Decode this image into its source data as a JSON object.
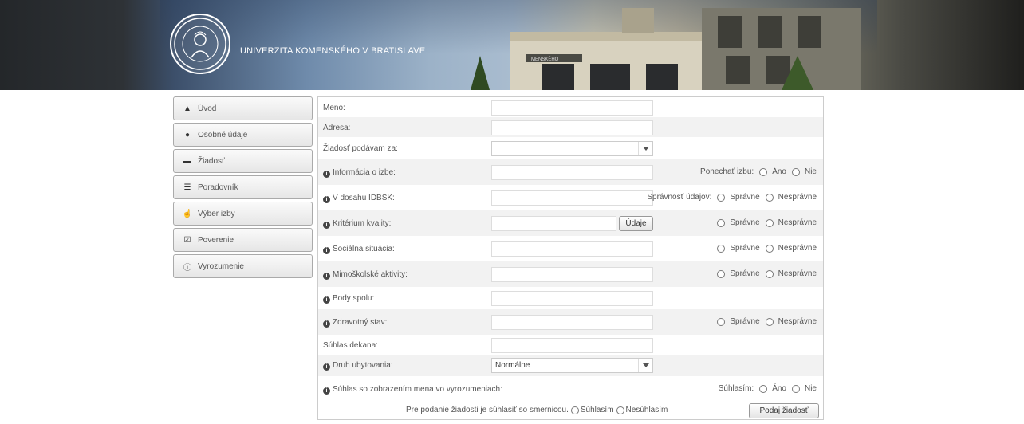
{
  "header": {
    "university_name": "UNIVERZITA KOMENSKÉHO V BRATISLAVE",
    "building_sign": "MENSKÉHO"
  },
  "sidebar": {
    "items": [
      {
        "label": "Úvod",
        "icon": "home-icon"
      },
      {
        "label": "Osobné údaje",
        "icon": "user-icon"
      },
      {
        "label": "Žiadosť",
        "icon": "card-icon"
      },
      {
        "label": "Poradovník",
        "icon": "list-icon"
      },
      {
        "label": "Výber izby",
        "icon": "hand-icon"
      },
      {
        "label": "Poverenie",
        "icon": "check-square-icon"
      },
      {
        "label": "Vyrozumenie",
        "icon": "info-icon"
      }
    ]
  },
  "form": {
    "meno": {
      "label": "Meno:"
    },
    "adresa": {
      "label": "Adresa:"
    },
    "ziadost_za": {
      "label": "Žiadosť podávam za:",
      "value": ""
    },
    "info_izba": {
      "label": "Informácia o izbe:",
      "right_label": "Ponechať izbu:",
      "opt1": "Áno",
      "opt2": "Nie"
    },
    "idbsk": {
      "label": "V dosahu IDBSK:",
      "right_label": "Správnosť údajov:",
      "opt1": "Správne",
      "opt2": "Nesprávne"
    },
    "kriterium": {
      "label": "Kritérium kvality:",
      "button": "Údaje",
      "opt1": "Správne",
      "opt2": "Nesprávne"
    },
    "socialna": {
      "label": "Sociálna situácia:",
      "opt1": "Správne",
      "opt2": "Nesprávne"
    },
    "mimoskolske": {
      "label": "Mimoškolské aktivity:",
      "opt1": "Správne",
      "opt2": "Nesprávne"
    },
    "body": {
      "label": "Body spolu:"
    },
    "zdravotny": {
      "label": "Zdravotný stav:",
      "opt1": "Správne",
      "opt2": "Nesprávne"
    },
    "suhlas_dekana": {
      "label": "Súhlas dekana:"
    },
    "druh": {
      "label": "Druh ubytovania:",
      "value": "Normálne"
    },
    "suhlas_meno": {
      "label": "Súhlas so zobrazením mena vo vyrozumeniach:",
      "right_label": "Súhlasím:",
      "opt1": "Áno",
      "opt2": "Nie"
    },
    "footer": {
      "text": "Pre podanie žiadosti je súhlasiť so smernicou.",
      "opt1": "Súhlasím",
      "opt2": "Nesúhlasím",
      "submit": "Podaj žiadosť"
    }
  }
}
